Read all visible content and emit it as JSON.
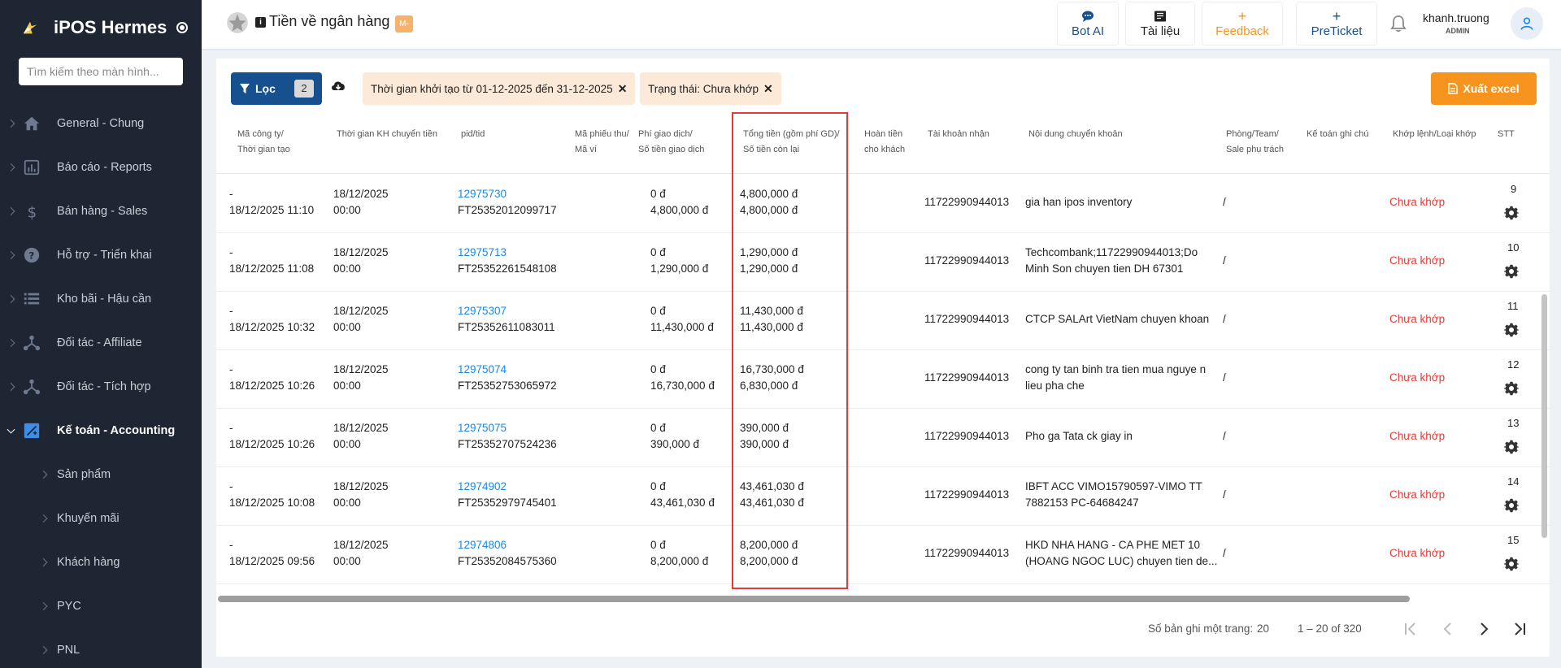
{
  "app": {
    "name": "iPOS Hermes"
  },
  "sidebar": {
    "search_placeholder": "Tìm kiếm theo màn hình...",
    "items": [
      {
        "label": "General - Chung",
        "icon": "home-icon"
      },
      {
        "label": "Báo cáo - Reports",
        "icon": "bar-chart-icon"
      },
      {
        "label": "Bán hàng - Sales",
        "icon": "dollar-icon"
      },
      {
        "label": "Hỗ trợ - Triển khai",
        "icon": "help-circle-icon"
      },
      {
        "label": "Kho bãi - Hậu cần",
        "icon": "list-icon"
      },
      {
        "label": "Đối tác - Affiliate",
        "icon": "network-icon"
      },
      {
        "label": "Đối tác - Tích hợp",
        "icon": "network-icon"
      },
      {
        "label": "Kế toán - Accounting",
        "icon": "accounting-icon",
        "active": true
      }
    ],
    "subitems": [
      {
        "label": "Sản phẩm"
      },
      {
        "label": "Khuyến mãi"
      },
      {
        "label": "Khách hàng"
      },
      {
        "label": "PYC"
      },
      {
        "label": "PNL"
      }
    ]
  },
  "header": {
    "title": "Tiền về ngân hàng",
    "badge": "M-",
    "buttons": [
      {
        "label": "Bot AI",
        "icon": "chat-icon",
        "color": "#17508f"
      },
      {
        "label": "Tài liệu",
        "icon": "book-icon",
        "color": "#222222"
      },
      {
        "label": "Feedback",
        "icon": "plus-icon",
        "color": "#f7941d"
      },
      {
        "label": "PreTicket",
        "icon": "plus-icon",
        "color": "#17508f"
      }
    ],
    "user": {
      "name": "khanh.truong",
      "role": "ADMIN"
    }
  },
  "toolbar": {
    "filter_label": "Lọc",
    "filter_count": "2",
    "chips": [
      {
        "label": "Thời gian khởi tạo từ 01-12-2025 đến 31-12-2025"
      },
      {
        "label": "Trạng thái: Chưa khớp"
      }
    ],
    "export_label": "Xuất excel"
  },
  "table": {
    "columns": [
      {
        "line1": "Mã công ty/",
        "line2": "Thời gian tạo"
      },
      {
        "line1": "Thời gian KH chuyển tiền",
        "line2": ""
      },
      {
        "line1": "pid/tid",
        "line2": ""
      },
      {
        "line1": "Mã phiếu thu/",
        "line2": "Mã ví"
      },
      {
        "line1": "Phí giao dịch/",
        "line2": "Số tiền giao dịch"
      },
      {
        "line1": "Tổng tiền (gồm phí GD)/",
        "line2": "Số tiền còn lại"
      },
      {
        "line1": "Hoàn tiền",
        "line2": "cho khách"
      },
      {
        "line1": "Tài khoản nhận",
        "line2": ""
      },
      {
        "line1": "Nội dung chuyển khoản",
        "line2": ""
      },
      {
        "line1": "Phòng/Team/",
        "line2": "Sale phụ trách"
      },
      {
        "line1": "Kế toán ghi chú",
        "line2": ""
      },
      {
        "line1": "Khớp lệnh/Loại khớp",
        "line2": ""
      },
      {
        "line1": "STT",
        "line2": ""
      }
    ],
    "rows": [
      {
        "company": "-",
        "created": "18/12/2025 11:10",
        "transfer_date": "18/12/2025",
        "transfer_time": "00:00",
        "pid": "12975730",
        "tid": "FT25352012099717",
        "fee": "0 đ",
        "amount": "4,800,000 đ",
        "total": "4,800,000 đ",
        "remaining": "4,800,000 đ",
        "account": "11722990944013",
        "content1": "gia han ipos inventory",
        "content2": "",
        "team": "/",
        "status": "Chưa khớp",
        "stt": "9"
      },
      {
        "company": "-",
        "created": "18/12/2025 11:08",
        "transfer_date": "18/12/2025",
        "transfer_time": "00:00",
        "pid": "12975713",
        "tid": "FT25352261548108",
        "fee": "0 đ",
        "amount": "1,290,000 đ",
        "total": "1,290,000 đ",
        "remaining": "1,290,000 đ",
        "account": "11722990944013",
        "content1": "Techcombank;11722990944013;Do",
        "content2": "Minh Son chuyen tien DH 67301",
        "team": "/",
        "status": "Chưa khớp",
        "stt": "10"
      },
      {
        "company": "-",
        "created": "18/12/2025 10:32",
        "transfer_date": "18/12/2025",
        "transfer_time": "00:00",
        "pid": "12975307",
        "tid": "FT25352611083011",
        "fee": "0 đ",
        "amount": "11,430,000 đ",
        "total": "11,430,000 đ",
        "remaining": "11,430,000 đ",
        "account": "11722990944013",
        "content1": "CTCP SALArt VietNam chuyen khoan",
        "content2": "",
        "team": "/",
        "status": "Chưa khớp",
        "stt": "11"
      },
      {
        "company": "-",
        "created": "18/12/2025 10:26",
        "transfer_date": "18/12/2025",
        "transfer_time": "00:00",
        "pid": "12975074",
        "tid": "FT25352753065972",
        "fee": "0 đ",
        "amount": "16,730,000 đ",
        "total": "16,730,000 đ",
        "remaining": "6,830,000 đ",
        "account": "11722990944013",
        "content1": "cong ty tan binh tra tien mua nguye n",
        "content2": "lieu pha che",
        "team": "/",
        "status": "Chưa khớp",
        "stt": "12"
      },
      {
        "company": "-",
        "created": "18/12/2025 10:26",
        "transfer_date": "18/12/2025",
        "transfer_time": "00:00",
        "pid": "12975075",
        "tid": "FT25352707524236",
        "fee": "0 đ",
        "amount": "390,000 đ",
        "total": "390,000 đ",
        "remaining": "390,000 đ",
        "account": "11722990944013",
        "content1": "Pho ga Tata ck giay in",
        "content2": "",
        "team": "/",
        "status": "Chưa khớp",
        "stt": "13"
      },
      {
        "company": "-",
        "created": "18/12/2025 10:08",
        "transfer_date": "18/12/2025",
        "transfer_time": "00:00",
        "pid": "12974902",
        "tid": "FT25352979745401",
        "fee": "0 đ",
        "amount": "43,461,030 đ",
        "total": "43,461,030 đ",
        "remaining": "43,461,030 đ",
        "account": "11722990944013",
        "content1": "IBFT ACC VIMO15790597-VIMO TT",
        "content2": "7882153 PC-64684247",
        "team": "/",
        "status": "Chưa khớp",
        "stt": "14"
      },
      {
        "company": "-",
        "created": "18/12/2025 09:56",
        "transfer_date": "18/12/2025",
        "transfer_time": "00:00",
        "pid": "12974806",
        "tid": "FT25352084575360",
        "fee": "0 đ",
        "amount": "8,200,000 đ",
        "total": "8,200,000 đ",
        "remaining": "8,200,000 đ",
        "account": "11722990944013",
        "content1": "HKD NHA HANG - CA PHE MET 10",
        "content2": "(HOANG NGOC LUC) chuyen tien de...",
        "team": "/",
        "status": "Chưa khớp",
        "stt": "15"
      }
    ]
  },
  "footer": {
    "rows_per_page_label": "Số bản ghi một trang:",
    "rows_per_page": "20",
    "range": "1 – 20 of 320"
  },
  "colors": {
    "sidebar_bg": "#1f2633",
    "primary": "#17508f",
    "accent": "#f7941d",
    "link": "#1e88e5",
    "status_unmatched": "#e53935",
    "highlight": "#e53935"
  }
}
